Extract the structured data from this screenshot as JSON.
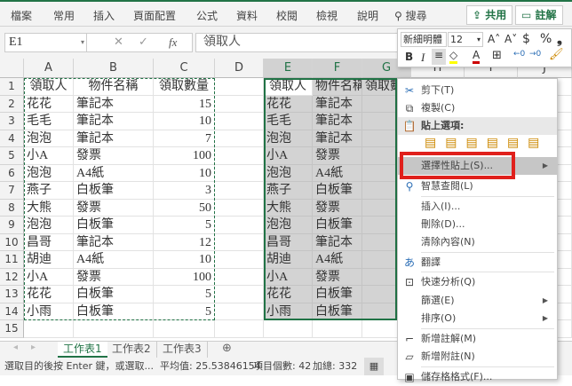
{
  "ribbon": {
    "tabs": [
      "檔案",
      "常用",
      "插入",
      "頁面配置",
      "公式",
      "資料",
      "校閱",
      "檢視",
      "說明"
    ],
    "search": "搜尋",
    "share": "共用",
    "comment": "註解"
  },
  "formula": {
    "namebox": "E1",
    "fx": "fx",
    "value": "領取人"
  },
  "columns": [
    "A",
    "B",
    "C",
    "D",
    "E",
    "F",
    "G",
    "H",
    "I",
    "J"
  ],
  "rows": [
    "1",
    "2",
    "3",
    "4",
    "5",
    "6",
    "7",
    "8",
    "9",
    "10",
    "11",
    "12",
    "13",
    "14",
    "15"
  ],
  "table": {
    "headers": [
      "領取人",
      "物件名稱",
      "領取數量"
    ],
    "data": [
      [
        "花花",
        "筆記本",
        "15"
      ],
      [
        "毛毛",
        "筆記本",
        "10"
      ],
      [
        "泡泡",
        "筆記本",
        "7"
      ],
      [
        "小A",
        "發票",
        "100"
      ],
      [
        "泡泡",
        "A4紙",
        "10"
      ],
      [
        "燕子",
        "白板筆",
        "3"
      ],
      [
        "大熊",
        "發票",
        "50"
      ],
      [
        "泡泡",
        "白板筆",
        "5"
      ],
      [
        "昌哥",
        "筆記本",
        "12"
      ],
      [
        "胡迪",
        "A4紙",
        "10"
      ],
      [
        "小A",
        "發票",
        "100"
      ],
      [
        "花花",
        "白板筆",
        "5"
      ],
      [
        "小雨",
        "白板筆",
        "5"
      ]
    ]
  },
  "copy_table": {
    "headers": [
      "領取人",
      "物件名稱",
      "領取數量"
    ],
    "data": [
      [
        "花花",
        "筆記本",
        ""
      ],
      [
        "毛毛",
        "筆記本",
        ""
      ],
      [
        "泡泡",
        "筆記本",
        ""
      ],
      [
        "小A",
        "發票",
        "1"
      ],
      [
        "泡泡",
        "A4紙",
        ""
      ],
      [
        "燕子",
        "白板筆",
        ""
      ],
      [
        "大熊",
        "發票",
        ""
      ],
      [
        "泡泡",
        "白板筆",
        ""
      ],
      [
        "昌哥",
        "筆記本",
        ""
      ],
      [
        "胡迪",
        "A4紙",
        ""
      ],
      [
        "小A",
        "發票",
        "1"
      ],
      [
        "花花",
        "白板筆",
        ""
      ],
      [
        "小雨",
        "白板筆",
        ""
      ]
    ]
  },
  "mini_toolbar": {
    "font": "新細明體",
    "size": "12",
    "bold": "B",
    "italic": "I",
    "currency": "$",
    "percent": "%",
    "comma": "❟"
  },
  "context_menu": {
    "cut": "剪下(T)",
    "copy": "複製(C)",
    "paste_options": "貼上選項:",
    "paste_special": "選擇性貼上(S)...",
    "smart_lookup": "智慧查閱(L)",
    "insert": "插入(I)...",
    "delete": "刪除(D)...",
    "clear": "清除內容(N)",
    "translate": "翻譯",
    "quick_analysis": "快速分析(Q)",
    "filter": "篩選(E)",
    "sort": "排序(O)",
    "new_comment": "新增註解(M)",
    "new_note": "新增附註(N)",
    "format_cells": "儲存格格式(F)..."
  },
  "sheets": [
    "工作表1",
    "工作表2",
    "工作表3"
  ],
  "status": {
    "message": "選取目的後按 Enter 鍵，或選取...",
    "average": "平均值: 25.53846154",
    "count": "項目個數: 42",
    "sum": "加總: 332"
  },
  "colors": {
    "accent": "#217346",
    "highlight": "#e0201c"
  }
}
